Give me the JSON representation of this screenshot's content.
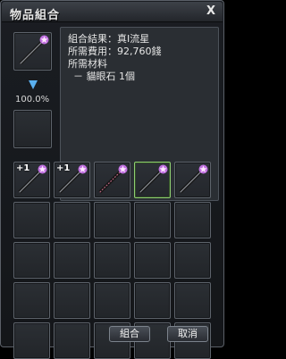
{
  "window": {
    "title": "物品組合",
    "close_label": "X"
  },
  "preview": {
    "success_rate": "100.0%"
  },
  "info": {
    "result_line": "組合結果：真I流星",
    "cost_line": "所需費用：92,760錢",
    "materials_header": "所需材料",
    "material_line": "－ 貓眼石 1個"
  },
  "inventory": {
    "rows": 5,
    "cols": 5,
    "items": [
      {
        "slot": 0,
        "icon": "dark-wand-icon",
        "plus": "+1",
        "gem": "pink-gem-icon"
      },
      {
        "slot": 1,
        "icon": "dark-wand-icon",
        "plus": "+1",
        "gem": "pink-gem-icon"
      },
      {
        "slot": 2,
        "icon": "pink-beaded-wand-icon",
        "plus": "",
        "gem": "pink-gem-icon"
      },
      {
        "slot": 3,
        "icon": "dark-wand-icon",
        "plus": "",
        "gem": "pink-gem-icon",
        "selected": true
      },
      {
        "slot": 4,
        "icon": "dark-wand-icon",
        "plus": "",
        "gem": "pink-gem-icon"
      }
    ]
  },
  "buttons": {
    "combine": "組合",
    "cancel": "取消"
  },
  "colors": {
    "selected_border": "#8fcf72",
    "gem": "#c070e0",
    "arrow": "#5ab0f0"
  }
}
